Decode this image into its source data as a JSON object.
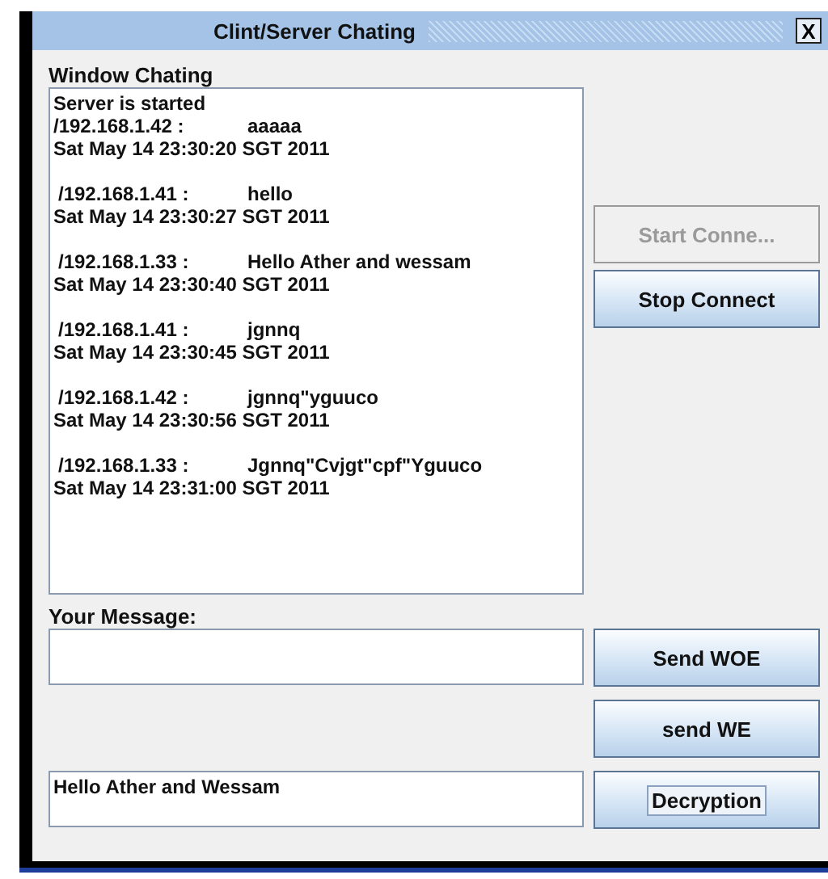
{
  "window": {
    "title": "Clint/Server Chating",
    "close": "X"
  },
  "chat": {
    "label": "Window Chating",
    "status": "Server is started",
    "messages": [
      {
        "sender": "/192.168.1.42 :",
        "text": "aaaaa",
        "time": "Sat May 14 23:30:20 SGT 2011"
      },
      {
        "sender": "/192.168.1.41 :",
        "text": "hello",
        "time": "Sat May 14 23:30:27 SGT 2011"
      },
      {
        "sender": "/192.168.1.33 :",
        "text": "Hello Ather and wessam",
        "time": "Sat May 14 23:30:40 SGT 2011"
      },
      {
        "sender": "/192.168.1.41 :",
        "text": "jgnnq",
        "time": "Sat May 14 23:30:45 SGT 2011"
      },
      {
        "sender": "/192.168.1.42 :",
        "text": "jgnnq\"yguuco",
        "time": "Sat May 14 23:30:56 SGT 2011"
      },
      {
        "sender": "/192.168.1.33 :",
        "text": "Jgnnq\"Cvjgt\"cpf\"Yguuco",
        "time": "Sat May 14 23:31:00 SGT 2011"
      }
    ]
  },
  "connection_buttons": [
    {
      "label": "Start Conne...",
      "disabled": true
    },
    {
      "label": "Stop Connect",
      "disabled": false
    }
  ],
  "message": {
    "label": "Your Message:"
  },
  "send_buttons": [
    {
      "label": "Send WOE",
      "focused": false
    },
    {
      "label": "send WE",
      "focused": false
    }
  ],
  "decryption": {
    "value": "Hello Ather and Wessam",
    "button": {
      "label": "Decryption",
      "focused": true
    }
  }
}
